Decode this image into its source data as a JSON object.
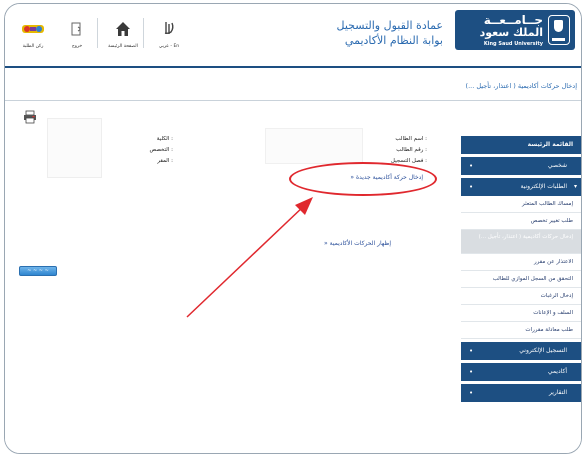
{
  "header": {
    "logo": {
      "line1": "جــامــعــة",
      "line2": "الملك سعود",
      "english": "King Saud University"
    },
    "deanship_line1": "عمادة القبول والتسجيل",
    "deanship_line2": "بوابة النظام الأكاديمي",
    "nav": [
      {
        "icon": "calligraphy-logo-icon",
        "label": "عربي - En"
      },
      {
        "icon": "home-icon",
        "label": "الصفحة الرئيسة"
      },
      {
        "icon": "exit-icon",
        "label": "خروج"
      },
      {
        "icon": "student-icon",
        "label": "ركن الطلبة"
      }
    ]
  },
  "breadcrumb": "إدخال حركات أكاديمية ( اعتذار، تأجيل ...)",
  "student_info": {
    "right": [
      "اسم الطالب :",
      "رقم الطالب :",
      "فصل التسجيل :"
    ],
    "left": [
      "الكلية :",
      "التخصص :",
      "المقر :"
    ]
  },
  "links": {
    "new_request": "» إدخال حركة أكاديمية جديدة",
    "show_moves": "» إظهار الحركات الأكاديمية"
  },
  "button_label": "~ ~ ~ ~",
  "sidebar": {
    "head": "القائمة الرئيسة",
    "items": [
      {
        "label": "شخصي",
        "bullet": "•"
      },
      {
        "label": "الطلبات الإلكترونية",
        "bullet": "•"
      }
    ],
    "subitems": [
      "إمساك الطالب المتعثر",
      "طلب تغيير تخصص",
      "إدخال حركات أكاديمية ( اعتذار، تأجيل ...)",
      "الاعتذار عن مقرر",
      "التحقق من السجل الموازي للطالب",
      "إدخال الرغبات",
      "السلف و الإعانات",
      "طلب معادلة مقررات"
    ],
    "bottom_items": [
      {
        "label": "التسجيل الإلكتروني",
        "bullet": "•"
      },
      {
        "label": "أكاديمي",
        "bullet": "•"
      },
      {
        "label": "التقارير",
        "bullet": "•"
      }
    ]
  },
  "colors": {
    "brand_blue": "#1d4f82",
    "link_blue": "#2a6ab0",
    "highlight_red": "#e0282e"
  }
}
